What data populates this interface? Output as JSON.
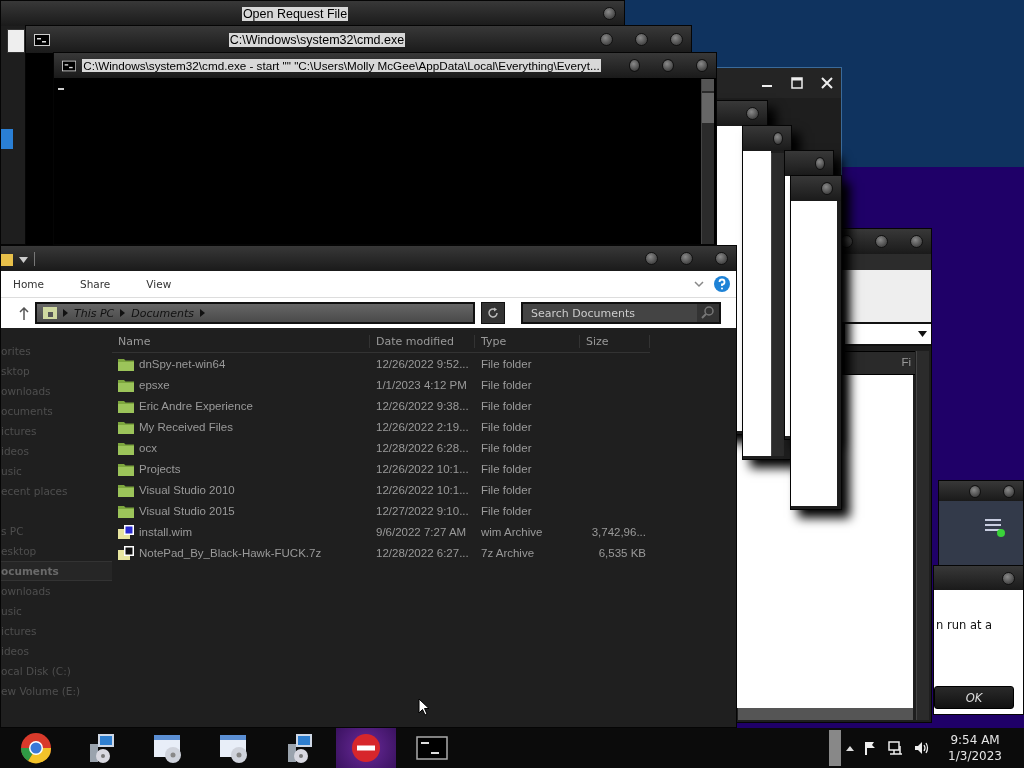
{
  "background_window": {
    "title": "Open Request File"
  },
  "cmd_window": {
    "title": "C:\\Windows\\system32\\cmd.exe"
  },
  "console_window": {
    "title": "C:\\Windows\\system32\\cmd.exe - start \"\" \"C:\\Users\\Molly McGee\\AppData\\Local\\Everything\\Everyt..."
  },
  "list_window": {
    "column_1": "Fi"
  },
  "explorer": {
    "ribbon_tabs": [
      {
        "label": "Home"
      },
      {
        "label": "Share"
      },
      {
        "label": "View"
      }
    ],
    "breadcrumb": [
      "This PC",
      "Documents"
    ],
    "search": {
      "placeholder": "Search Documents"
    },
    "sidebar": {
      "groups": [
        {
          "label": "orites",
          "selected": false,
          "children": [
            {
              "label": "sktop",
              "selected": false
            },
            {
              "label": "ownloads",
              "selected": false
            },
            {
              "label": "ocuments",
              "selected": false
            },
            {
              "label": "ictures",
              "selected": false
            },
            {
              "label": "ideos",
              "selected": false
            },
            {
              "label": "usic",
              "selected": false
            },
            {
              "label": "ecent places",
              "selected": false
            }
          ]
        },
        {
          "label": "s PC",
          "selected": false,
          "children": [
            {
              "label": "esktop",
              "selected": false
            },
            {
              "label": "ocuments",
              "selected": true
            },
            {
              "label": "ownloads",
              "selected": false
            },
            {
              "label": "usic",
              "selected": false
            },
            {
              "label": "ictures",
              "selected": false
            },
            {
              "label": "ideos",
              "selected": false
            },
            {
              "label": "ocal Disk (C:)",
              "selected": false
            },
            {
              "label": "ew Volume (E:)",
              "selected": false
            }
          ]
        }
      ]
    },
    "columns": [
      "Name",
      "Date modified",
      "Type",
      "Size"
    ],
    "rows": [
      {
        "kind": "folder",
        "name": "dnSpy-net-win64",
        "date": "12/26/2022 9:52...",
        "type": "File folder"
      },
      {
        "kind": "folder",
        "name": "epsxe",
        "date": "1/1/2023 4:12 PM",
        "type": "File folder"
      },
      {
        "kind": "folder",
        "name": "Eric Andre Experience",
        "date": "12/26/2022 9:38...",
        "type": "File folder"
      },
      {
        "kind": "folder",
        "name": "My Received Files",
        "date": "12/26/2022 2:19...",
        "type": "File folder"
      },
      {
        "kind": "folder",
        "name": "ocx",
        "date": "12/28/2022 6:28...",
        "type": "File folder"
      },
      {
        "kind": "folder",
        "name": "Projects",
        "date": "12/26/2022 10:1...",
        "type": "File folder"
      },
      {
        "kind": "folder",
        "name": "Visual Studio 2010",
        "date": "12/26/2022 10:1...",
        "type": "File folder"
      },
      {
        "kind": "folder",
        "name": "Visual Studio 2015",
        "date": "12/27/2022 9:10...",
        "type": "File folder"
      },
      {
        "kind": "wim",
        "name": "install.wim",
        "date": "9/6/2022 7:27 AM",
        "type": "wim Archive",
        "size": "3,742,96..."
      },
      {
        "kind": "sevenzip",
        "name": "NotePad_By_Black-Hawk-FUCK.7z",
        "date": "12/28/2022 6:27...",
        "type": "7z Archive",
        "size": "6,535 KB"
      }
    ]
  },
  "dialog": {
    "message": "n run at a",
    "button": "OK"
  },
  "taskbar": {
    "buttons": [
      {
        "kind": "browser",
        "selected": false
      },
      {
        "kind": "installer",
        "selected": false
      },
      {
        "kind": "disc-window",
        "selected": false
      },
      {
        "kind": "disc-window",
        "selected": false
      },
      {
        "kind": "installer",
        "selected": false
      },
      {
        "kind": "stop",
        "selected": true
      },
      {
        "kind": "console",
        "selected": false
      }
    ],
    "time": "9:54 AM",
    "date": "1/3/2023"
  }
}
